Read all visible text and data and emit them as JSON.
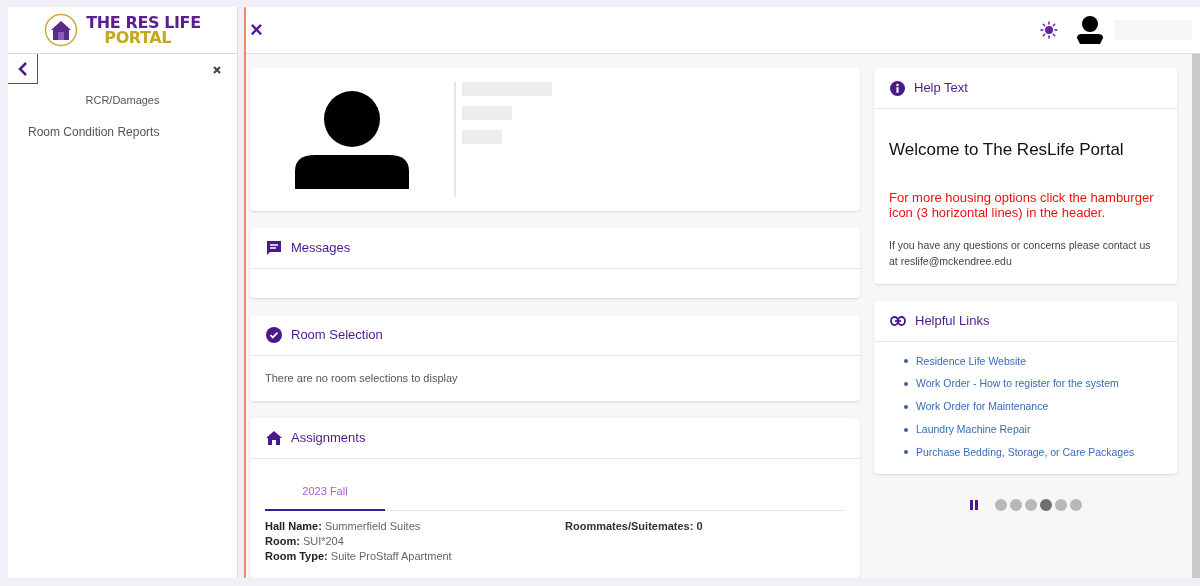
{
  "logo": {
    "line_1": "THE RES LIFE",
    "line_2": "PORTAL"
  },
  "sidebar": {
    "section": "RCR/Damages",
    "items": [
      {
        "label": "Room Condition Reports"
      }
    ]
  },
  "header": {
    "close": "×"
  },
  "messages": {
    "title": "Messages"
  },
  "room_selection": {
    "title": "Room Selection",
    "text": "There are no room selections to display"
  },
  "assignments": {
    "title": "Assignments",
    "tabs": [
      {
        "label": "2023 Fall",
        "selected": true
      }
    ],
    "fields": [
      {
        "label": "Hall Name:",
        "value": "Summerfield Suites"
      },
      {
        "label": "Room:",
        "value": "SUI*204"
      },
      {
        "label": "Room Type:",
        "value": "Suite ProStaff Apartment"
      }
    ],
    "roommates": {
      "label": "Roommates/Suitemates:",
      "value": "0"
    }
  },
  "help_text": {
    "title": "Help Text",
    "welcome": "Welcome to The ResLife Portal",
    "notice": "For more housing options click the hamburger icon (3 horizontal lines) in the header.",
    "contact": "If you have any questions or concerns please contact us at reslife@mckendree.edu"
  },
  "helpful_links": {
    "title": "Helpful Links",
    "links": [
      "Residence Life Website",
      "Work Order - How to register for the system",
      "Work Order for Maintenance",
      "Laundry Machine Repair",
      "Purchase Bedding, Storage, or Care Packages"
    ]
  },
  "carousel": {
    "dots": [
      {
        "selected": false
      },
      {
        "selected": false
      },
      {
        "selected": false
      },
      {
        "selected": true
      },
      {
        "selected": false
      },
      {
        "selected": false
      }
    ]
  }
}
